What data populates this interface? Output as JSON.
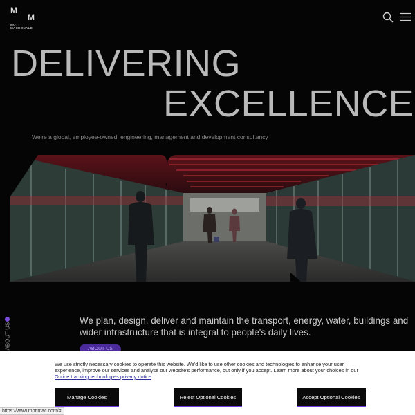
{
  "header": {
    "logo": {
      "mark_top": "M",
      "mark_bottom": "M",
      "word1": "MOTT",
      "word2": "MACDONALD"
    },
    "icons": {
      "search": "search-icon",
      "menu": "hamburger-menu-icon"
    }
  },
  "hero": {
    "line1": "DELIVERING",
    "line2": "EXCELLENCE",
    "subtitle": "We're a global, employee-owned, engineering, management and development consultancy"
  },
  "about": {
    "side_label": "ABOUT US",
    "mission": "We plan, design, deliver and maintain the transport, energy, water, buildings and wider infrastructure that is integral to people's daily lives.",
    "button_label": "ABOUT US"
  },
  "cookie_banner": {
    "text": "We use strictly necessary cookies to operate this website. We'd like to use other cookies and technologies to enhance your user experience, improve our services and analyse our website's performance, but only if you accept. Learn more about your choices in our ",
    "link_text": "Online tracking technologies privacy notice",
    "text_end": ".",
    "buttons": {
      "manage": "Manage Cookies",
      "reject": "Reject Optional Cookies",
      "accept": "Accept Optional Cookies"
    }
  },
  "status_bar": {
    "url": "https://www.mottmac.com/#"
  },
  "colors": {
    "background": "#050505",
    "accent": "#6d3ee0",
    "hero_text": "#b9b9b9"
  }
}
